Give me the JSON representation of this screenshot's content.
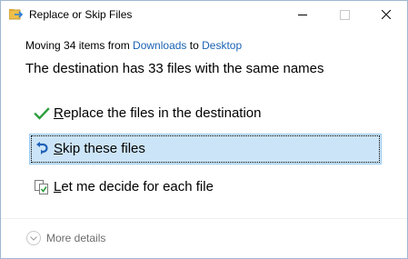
{
  "window": {
    "title": "Replace or Skip Files",
    "controls": {
      "minimize": "minimize",
      "maximize": "maximize",
      "close": "close"
    }
  },
  "status": {
    "moving_prefix": "Moving 34 items from ",
    "source": "Downloads",
    "connector": " to ",
    "destination": "Desktop"
  },
  "headline": "The destination has 33 files with the same names",
  "options": [
    {
      "mnemonic": "R",
      "rest": "eplace the files in the destination",
      "icon": "checkmark-icon"
    },
    {
      "mnemonic": "S",
      "rest": "kip these files",
      "icon": "skip-arrow-icon",
      "selected": true
    },
    {
      "mnemonic": "L",
      "rest": "et me decide for each file",
      "icon": "compare-files-icon"
    }
  ],
  "footer": {
    "more_details": "More details",
    "icon": "chevron-down-icon"
  },
  "colors": {
    "link": "#1a62b4",
    "selection_bg": "#cce4f7",
    "selection_border": "#99c9ef",
    "check_green": "#2e9e3e"
  }
}
